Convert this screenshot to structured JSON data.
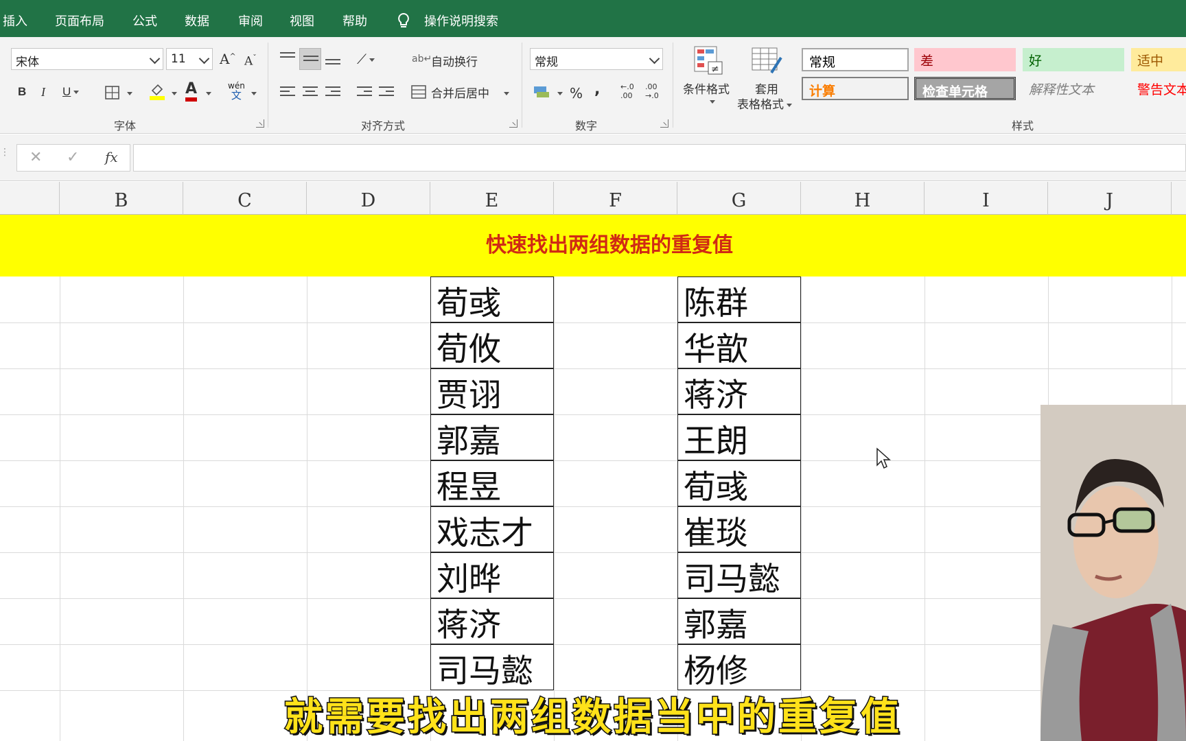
{
  "menu": {
    "tabs": [
      "插入",
      "页面布局",
      "公式",
      "数据",
      "审阅",
      "视图",
      "帮助"
    ],
    "tell_me": "操作说明搜索"
  },
  "ribbon": {
    "font": {
      "name": "宋体",
      "size": "11",
      "grow": "A",
      "shrink": "A",
      "bold": "B",
      "italic": "I",
      "underline": "U",
      "font_color_glyph": "A",
      "phonetic_top": "wén",
      "phonetic_bottom": "文",
      "group_label": "字体"
    },
    "alignment": {
      "wrap_text": "自动换行",
      "merge_center": "合并后居中",
      "group_label": "对齐方式"
    },
    "number": {
      "format": "常规",
      "percent": "%",
      "comma": ",",
      "inc_decimal_top": "←.0",
      "inc_decimal_bottom": ".00",
      "dec_decimal_top": ".00",
      "dec_decimal_bottom": "→.0",
      "group_label": "数字"
    },
    "styles": {
      "conditional_format": "条件格式",
      "table_format_line1": "套用",
      "table_format_line2": "表格格式",
      "cells": {
        "normal": "常规",
        "bad": "差",
        "good": "好",
        "neutral": "适中",
        "calculation": "计算",
        "check_cell": "检查单元格",
        "explanatory": "解释性文本",
        "warning": "警告文本"
      },
      "group_label": "样式"
    }
  },
  "formula_bar": {
    "cancel": "✕",
    "enter": "✓",
    "fx": "fx",
    "value": ""
  },
  "columns": [
    "B",
    "C",
    "D",
    "E",
    "F",
    "G",
    "H",
    "I",
    "J"
  ],
  "sheet": {
    "title": "快速找出两组数据的重复值",
    "group1": [
      "荀彧",
      "荀攸",
      "贾诩",
      "郭嘉",
      "程昱",
      "戏志才",
      "刘晔",
      "蒋济",
      "司马懿"
    ],
    "group2": [
      "陈群",
      "华歆",
      "蒋济",
      "王朗",
      "荀彧",
      "崔琰",
      "司马懿",
      "郭嘉",
      "杨修"
    ]
  },
  "subtitle": "就需要找出两组数据当中的重复值",
  "colors": {
    "menu_bg": "#217346",
    "title_band": "#ffff00",
    "title_text": "#d02a14",
    "subtitle_fill": "#ffe21a",
    "style_bad_bg": "#ffc7ce",
    "style_good_bg": "#c6efce",
    "style_neutral_bg": "#ffeb9c",
    "style_check_bg": "#a5a5a5"
  }
}
